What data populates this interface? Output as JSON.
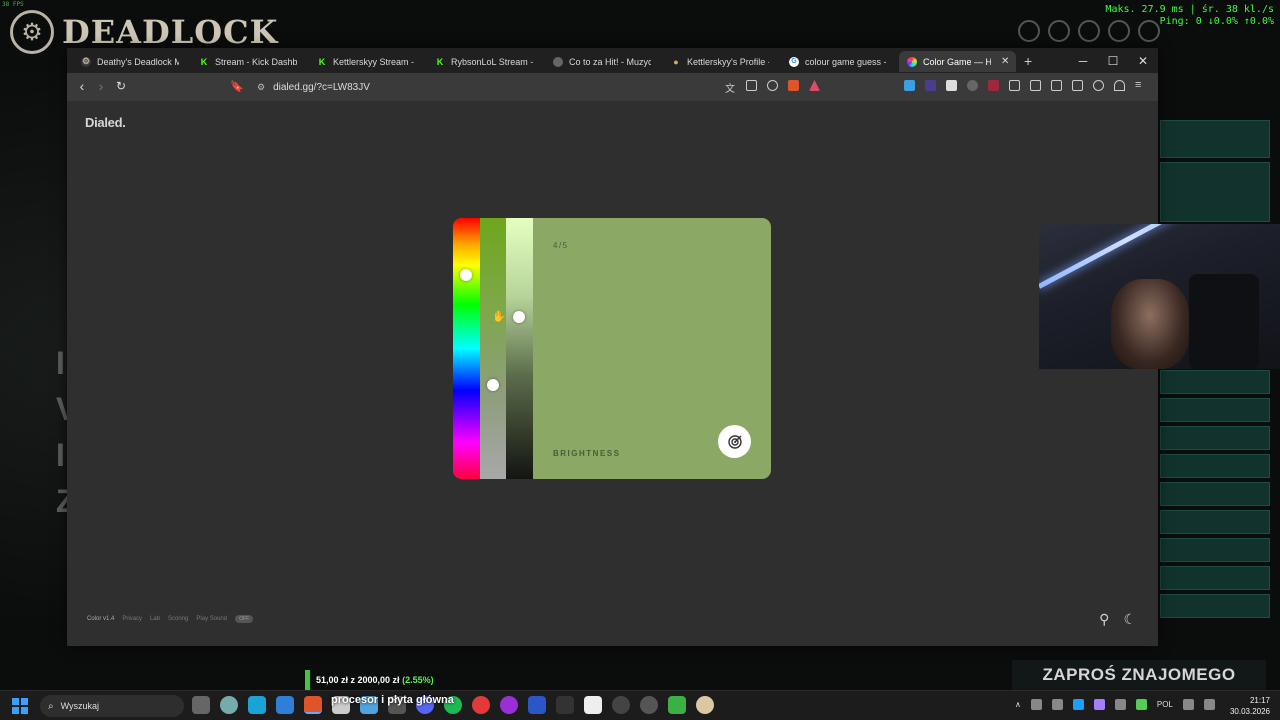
{
  "desktop": {
    "fps_label": "38 FPS",
    "game_title": "DEADLOCK",
    "stats_line1": "Maks. 27.9 ms | śr. 38 kl./s",
    "stats_line2": "Ping: 0  ↓0.0%  ↑0.0%",
    "left_letters": [
      "I",
      "V",
      "I",
      "Z"
    ]
  },
  "browser": {
    "tabs": [
      {
        "title": "Deathy's Deadlock Meta",
        "icon": "deadlock-icon",
        "color": "#b9b3a3"
      },
      {
        "title": "Stream - Kick Dashboard",
        "icon": "kick-icon",
        "color": "#53fc18"
      },
      {
        "title": "Kettlerskyy Stream - Wa",
        "icon": "kick-icon",
        "color": "#53fc18"
      },
      {
        "title": "RybsonLoL Stream - Wa",
        "icon": "kick-icon",
        "color": "#53fc18"
      },
      {
        "title": "Co to za Hit! - Muzyczn",
        "icon": "globe-icon",
        "color": "#888888"
      },
      {
        "title": "Kettlerskyy's Profile - St",
        "icon": "profile-icon",
        "color": "#c9b060"
      },
      {
        "title": "colour game guess - Sz",
        "icon": "google-icon",
        "color": "#ffffff"
      },
      {
        "title": "Color Game — How",
        "icon": "colorwheel-icon",
        "color": "#e040a0",
        "active": true
      }
    ],
    "url": "dialed.gg/?c=LW83JV"
  },
  "page": {
    "brand": "Dialed.",
    "progress": "4/5",
    "mode_label": "BRIGHTNESS",
    "target_color": "#8ba864",
    "sliders": {
      "hue_position_pct": 22,
      "saturation_position_pct": 64,
      "brightness_position_pct": 38
    },
    "footer": {
      "version": "Color v1.4",
      "links": [
        "Privacy",
        "Lab",
        "Scoring",
        "Play Sound"
      ],
      "pill": "OFF"
    }
  },
  "overlay": {
    "donation_text": "51,00 zł z 2000,00 zł",
    "donation_pct": "(2.55%)",
    "donation_fraction": 0.0255,
    "invite": "ZAPROŚ ZNAJOMEGO",
    "caption": "procesor i płyta główna"
  },
  "taskbar": {
    "search_placeholder": "Wyszukaj",
    "language": "POL",
    "time": "21:17",
    "date": "30.03.2026"
  }
}
